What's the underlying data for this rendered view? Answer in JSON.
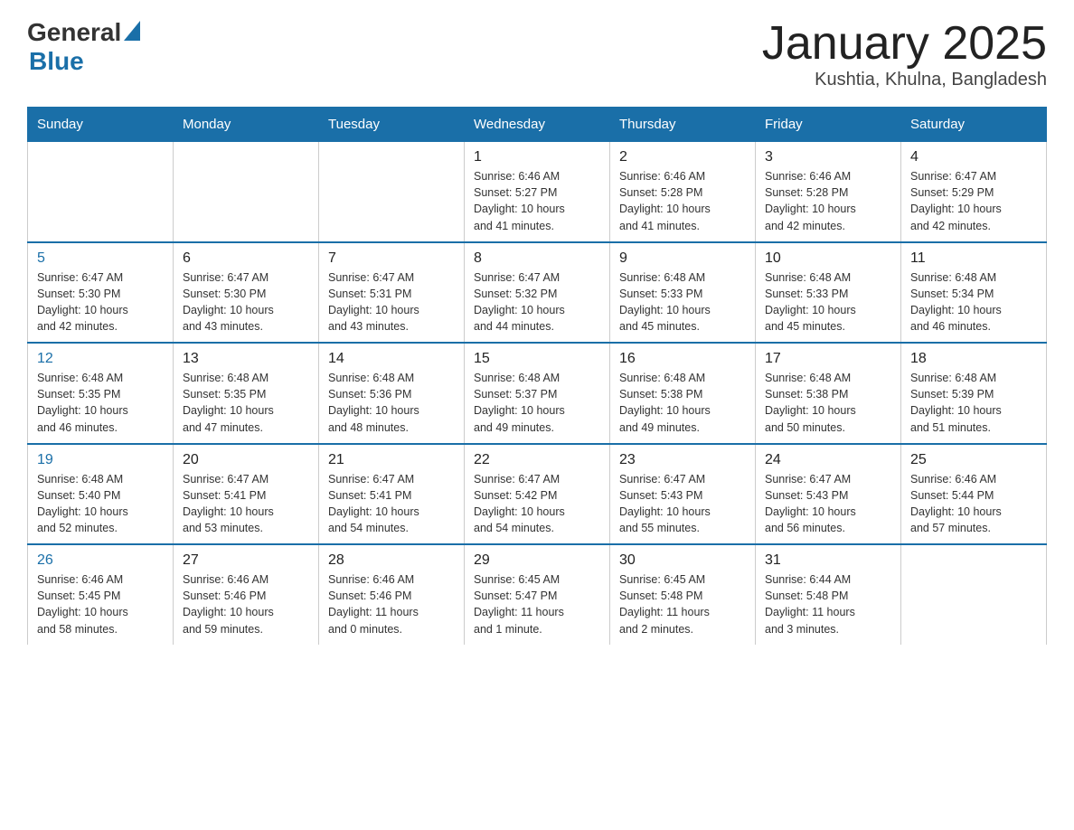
{
  "header": {
    "logo_general": "General",
    "logo_blue": "Blue",
    "title": "January 2025",
    "subtitle": "Kushtia, Khulna, Bangladesh"
  },
  "days_of_week": [
    "Sunday",
    "Monday",
    "Tuesday",
    "Wednesday",
    "Thursday",
    "Friday",
    "Saturday"
  ],
  "weeks": [
    [
      {
        "day": "",
        "info": ""
      },
      {
        "day": "",
        "info": ""
      },
      {
        "day": "",
        "info": ""
      },
      {
        "day": "1",
        "info": "Sunrise: 6:46 AM\nSunset: 5:27 PM\nDaylight: 10 hours\nand 41 minutes."
      },
      {
        "day": "2",
        "info": "Sunrise: 6:46 AM\nSunset: 5:28 PM\nDaylight: 10 hours\nand 41 minutes."
      },
      {
        "day": "3",
        "info": "Sunrise: 6:46 AM\nSunset: 5:28 PM\nDaylight: 10 hours\nand 42 minutes."
      },
      {
        "day": "4",
        "info": "Sunrise: 6:47 AM\nSunset: 5:29 PM\nDaylight: 10 hours\nand 42 minutes."
      }
    ],
    [
      {
        "day": "5",
        "info": "Sunrise: 6:47 AM\nSunset: 5:30 PM\nDaylight: 10 hours\nand 42 minutes."
      },
      {
        "day": "6",
        "info": "Sunrise: 6:47 AM\nSunset: 5:30 PM\nDaylight: 10 hours\nand 43 minutes."
      },
      {
        "day": "7",
        "info": "Sunrise: 6:47 AM\nSunset: 5:31 PM\nDaylight: 10 hours\nand 43 minutes."
      },
      {
        "day": "8",
        "info": "Sunrise: 6:47 AM\nSunset: 5:32 PM\nDaylight: 10 hours\nand 44 minutes."
      },
      {
        "day": "9",
        "info": "Sunrise: 6:48 AM\nSunset: 5:33 PM\nDaylight: 10 hours\nand 45 minutes."
      },
      {
        "day": "10",
        "info": "Sunrise: 6:48 AM\nSunset: 5:33 PM\nDaylight: 10 hours\nand 45 minutes."
      },
      {
        "day": "11",
        "info": "Sunrise: 6:48 AM\nSunset: 5:34 PM\nDaylight: 10 hours\nand 46 minutes."
      }
    ],
    [
      {
        "day": "12",
        "info": "Sunrise: 6:48 AM\nSunset: 5:35 PM\nDaylight: 10 hours\nand 46 minutes."
      },
      {
        "day": "13",
        "info": "Sunrise: 6:48 AM\nSunset: 5:35 PM\nDaylight: 10 hours\nand 47 minutes."
      },
      {
        "day": "14",
        "info": "Sunrise: 6:48 AM\nSunset: 5:36 PM\nDaylight: 10 hours\nand 48 minutes."
      },
      {
        "day": "15",
        "info": "Sunrise: 6:48 AM\nSunset: 5:37 PM\nDaylight: 10 hours\nand 49 minutes."
      },
      {
        "day": "16",
        "info": "Sunrise: 6:48 AM\nSunset: 5:38 PM\nDaylight: 10 hours\nand 49 minutes."
      },
      {
        "day": "17",
        "info": "Sunrise: 6:48 AM\nSunset: 5:38 PM\nDaylight: 10 hours\nand 50 minutes."
      },
      {
        "day": "18",
        "info": "Sunrise: 6:48 AM\nSunset: 5:39 PM\nDaylight: 10 hours\nand 51 minutes."
      }
    ],
    [
      {
        "day": "19",
        "info": "Sunrise: 6:48 AM\nSunset: 5:40 PM\nDaylight: 10 hours\nand 52 minutes."
      },
      {
        "day": "20",
        "info": "Sunrise: 6:47 AM\nSunset: 5:41 PM\nDaylight: 10 hours\nand 53 minutes."
      },
      {
        "day": "21",
        "info": "Sunrise: 6:47 AM\nSunset: 5:41 PM\nDaylight: 10 hours\nand 54 minutes."
      },
      {
        "day": "22",
        "info": "Sunrise: 6:47 AM\nSunset: 5:42 PM\nDaylight: 10 hours\nand 54 minutes."
      },
      {
        "day": "23",
        "info": "Sunrise: 6:47 AM\nSunset: 5:43 PM\nDaylight: 10 hours\nand 55 minutes."
      },
      {
        "day": "24",
        "info": "Sunrise: 6:47 AM\nSunset: 5:43 PM\nDaylight: 10 hours\nand 56 minutes."
      },
      {
        "day": "25",
        "info": "Sunrise: 6:46 AM\nSunset: 5:44 PM\nDaylight: 10 hours\nand 57 minutes."
      }
    ],
    [
      {
        "day": "26",
        "info": "Sunrise: 6:46 AM\nSunset: 5:45 PM\nDaylight: 10 hours\nand 58 minutes."
      },
      {
        "day": "27",
        "info": "Sunrise: 6:46 AM\nSunset: 5:46 PM\nDaylight: 10 hours\nand 59 minutes."
      },
      {
        "day": "28",
        "info": "Sunrise: 6:46 AM\nSunset: 5:46 PM\nDaylight: 11 hours\nand 0 minutes."
      },
      {
        "day": "29",
        "info": "Sunrise: 6:45 AM\nSunset: 5:47 PM\nDaylight: 11 hours\nand 1 minute."
      },
      {
        "day": "30",
        "info": "Sunrise: 6:45 AM\nSunset: 5:48 PM\nDaylight: 11 hours\nand 2 minutes."
      },
      {
        "day": "31",
        "info": "Sunrise: 6:44 AM\nSunset: 5:48 PM\nDaylight: 11 hours\nand 3 minutes."
      },
      {
        "day": "",
        "info": ""
      }
    ]
  ]
}
